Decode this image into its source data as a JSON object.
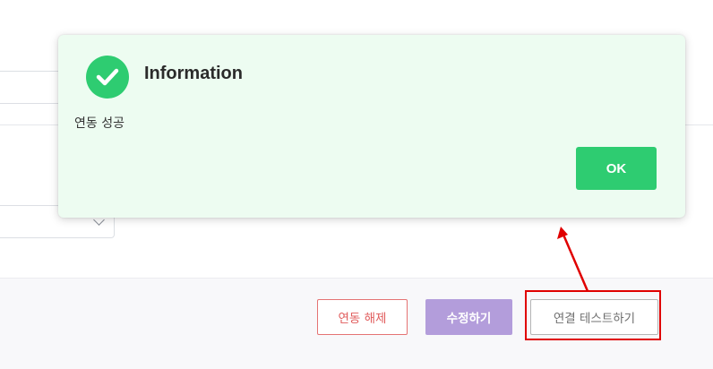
{
  "dialog": {
    "title": "Information",
    "message": "연동 성공",
    "ok_label": "OK",
    "icon": "check-circle-icon",
    "accent_color": "#2ecc71",
    "background_color": "#edfcf1"
  },
  "footer": {
    "unlink_label": "연동 해제",
    "edit_label": "수정하기",
    "test_connection_label": "연결 테스트하기"
  },
  "colors": {
    "unlink": "#e05a5a",
    "edit": "#b39ddb",
    "highlight": "#e00000"
  }
}
